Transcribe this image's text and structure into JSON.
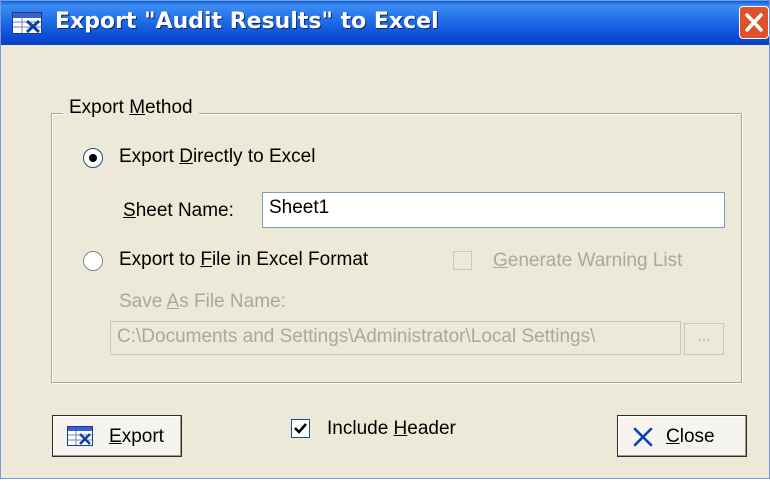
{
  "window": {
    "title": "Export \"Audit Results\" to Excel",
    "close_glyph": "✕"
  },
  "group": {
    "legend_pre": "Export ",
    "legend_ul": "M",
    "legend_post": "ethod"
  },
  "option_direct": {
    "pre": "Export ",
    "ul": "D",
    "post": "irectly to Excel",
    "checked": true
  },
  "sheet": {
    "label_ul": "S",
    "label_post": "heet Name:",
    "value": "Sheet1"
  },
  "option_file": {
    "pre": "Export to ",
    "ul": "F",
    "post": "ile in Excel Format",
    "checked": false
  },
  "warning": {
    "ul": "G",
    "post": "enerate Warning List",
    "checked": false,
    "enabled": false
  },
  "saveas": {
    "pre": "Save ",
    "ul": "A",
    "post": "s File Name:",
    "value": "C:\\Documents and Settings\\Administrator\\Local Settings\\",
    "browse_label": "..."
  },
  "buttons": {
    "export_pre": "E",
    "export_post": "xport",
    "close_ul": "C",
    "close_post": "lose"
  },
  "include_header": {
    "pre": "Include ",
    "ul": "H",
    "post": "eader",
    "checked": true
  },
  "colors": {
    "titlebar": "#0a4fd6",
    "dialog_bg": "#ece9d8",
    "close_red": "#e0502a",
    "disabled_text": "#aca899"
  },
  "icons": [
    "excel-export-icon",
    "close-x-icon",
    "window-close-icon"
  ]
}
